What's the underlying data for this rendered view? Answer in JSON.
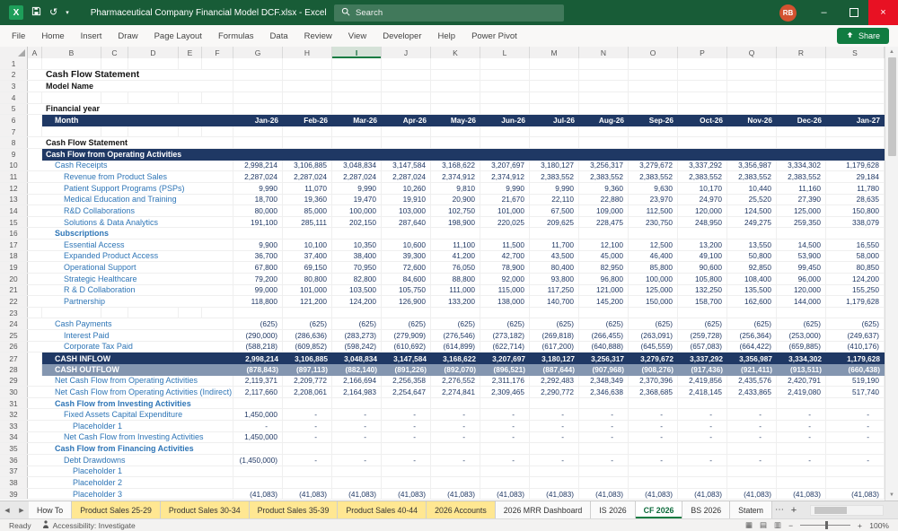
{
  "titlebar": {
    "title": "Pharmaceutical Company Financial Model DCF.xlsx  -  Excel",
    "search_placeholder": "Search",
    "avatar_initials": "RB"
  },
  "ribbon": {
    "tabs": [
      "File",
      "Home",
      "Insert",
      "Draw",
      "Page Layout",
      "Formulas",
      "Data",
      "Review",
      "View",
      "Developer",
      "Help",
      "Power Pivot"
    ],
    "share_label": "Share"
  },
  "icons": {
    "app": "X",
    "undo": "↺",
    "dropdown": "▾",
    "minimize": "–",
    "close": "×",
    "up": "▲",
    "down": "▼",
    "tab_prev": "◀",
    "tab_next": "▶",
    "more": "⋯",
    "add": "+",
    "view_normal": "▦",
    "view_layout": "▤",
    "view_break": "▥",
    "zoom_out": "−",
    "zoom_in": "+"
  },
  "grid": {
    "columns": [
      "A",
      "B",
      "C",
      "D",
      "E",
      "F",
      "G",
      "H",
      "I",
      "J",
      "K",
      "L",
      "M",
      "N",
      "O",
      "P",
      "Q",
      "R",
      "S"
    ],
    "selected_column": "I",
    "rows": [
      {
        "n": 1
      },
      {
        "n": 2,
        "s": "title",
        "t": "Cash Flow Statement"
      },
      {
        "n": 3,
        "s": "bold",
        "t": "Model Name"
      },
      {
        "n": 4
      },
      {
        "n": 5,
        "s": "bold",
        "t": "Financial year"
      },
      {
        "n": 6,
        "s": "months",
        "t": "Month",
        "v": [
          "Jan-26",
          "Feb-26",
          "Mar-26",
          "Apr-26",
          "May-26",
          "Jun-26",
          "Jul-26",
          "Aug-26",
          "Sep-26",
          "Oct-26",
          "Nov-26",
          "Dec-26",
          "Jan-27"
        ]
      },
      {
        "n": 7
      },
      {
        "n": 8,
        "s": "bold",
        "t": "Cash Flow Statement"
      },
      {
        "n": 9,
        "s": "band",
        "t": "Cash Flow from Operating Activities"
      },
      {
        "n": 10,
        "s": "lbl",
        "i": 1,
        "t": "Cash Receipts",
        "v": [
          "2,998,214",
          "3,106,885",
          "3,048,834",
          "3,147,584",
          "3,168,622",
          "3,207,697",
          "3,180,127",
          "3,256,317",
          "3,279,672",
          "3,337,292",
          "3,356,987",
          "3,334,302",
          "1,179,628"
        ]
      },
      {
        "n": 11,
        "s": "lbl",
        "i": 2,
        "t": "Revenue from Product Sales",
        "v": [
          "2,287,024",
          "2,287,024",
          "2,287,024",
          "2,287,024",
          "2,374,912",
          "2,374,912",
          "2,383,552",
          "2,383,552",
          "2,383,552",
          "2,383,552",
          "2,383,552",
          "2,383,552",
          "29,184"
        ]
      },
      {
        "n": 12,
        "s": "lbl",
        "i": 2,
        "t": "Patient Support Programs (PSPs)",
        "v": [
          "9,990",
          "11,070",
          "9,990",
          "10,260",
          "9,810",
          "9,990",
          "9,990",
          "9,360",
          "9,630",
          "10,170",
          "10,440",
          "11,160",
          "11,780"
        ]
      },
      {
        "n": 13,
        "s": "lbl",
        "i": 2,
        "t": "Medical Education and Training",
        "v": [
          "18,700",
          "19,360",
          "19,470",
          "19,910",
          "20,900",
          "21,670",
          "22,110",
          "22,880",
          "23,970",
          "24,970",
          "25,520",
          "27,390",
          "28,635"
        ]
      },
      {
        "n": 14,
        "s": "lbl",
        "i": 2,
        "t": "R&D Collaborations",
        "v": [
          "80,000",
          "85,000",
          "100,000",
          "103,000",
          "102,750",
          "101,000",
          "67,500",
          "109,000",
          "112,500",
          "120,000",
          "124,500",
          "125,000",
          "150,800"
        ]
      },
      {
        "n": 15,
        "s": "lbl",
        "i": 2,
        "t": "Solutions & Data Analytics",
        "v": [
          "191,100",
          "285,111",
          "202,150",
          "287,640",
          "198,900",
          "220,025",
          "209,625",
          "228,475",
          "230,750",
          "248,950",
          "249,275",
          "259,350",
          "338,079"
        ]
      },
      {
        "n": 16,
        "s": "sec",
        "i": 1,
        "t": "Subscriptions"
      },
      {
        "n": 17,
        "s": "lbl",
        "i": 2,
        "t": "Essential Access",
        "v": [
          "9,900",
          "10,100",
          "10,350",
          "10,600",
          "11,100",
          "11,500",
          "11,700",
          "12,100",
          "12,500",
          "13,200",
          "13,550",
          "14,500",
          "16,550"
        ]
      },
      {
        "n": 18,
        "s": "lbl",
        "i": 2,
        "t": "Expanded Product Access",
        "v": [
          "36,700",
          "37,400",
          "38,400",
          "39,300",
          "41,200",
          "42,700",
          "43,500",
          "45,000",
          "46,400",
          "49,100",
          "50,800",
          "53,900",
          "58,000"
        ]
      },
      {
        "n": 19,
        "s": "lbl",
        "i": 2,
        "t": "Operational Support",
        "v": [
          "67,800",
          "69,150",
          "70,950",
          "72,600",
          "76,050",
          "78,900",
          "80,400",
          "82,950",
          "85,800",
          "90,600",
          "92,850",
          "99,450",
          "80,850"
        ]
      },
      {
        "n": 20,
        "s": "lbl",
        "i": 2,
        "t": "Strategic Healthcare",
        "v": [
          "79,200",
          "80,800",
          "82,800",
          "84,600",
          "88,800",
          "92,000",
          "93,800",
          "96,800",
          "100,000",
          "105,800",
          "108,400",
          "96,000",
          "124,200"
        ]
      },
      {
        "n": 21,
        "s": "lbl",
        "i": 2,
        "t": "R & D Collaboration",
        "v": [
          "99,000",
          "101,000",
          "103,500",
          "105,750",
          "111,000",
          "115,000",
          "117,250",
          "121,000",
          "125,000",
          "132,250",
          "135,500",
          "120,000",
          "155,250"
        ]
      },
      {
        "n": 22,
        "s": "lbl",
        "i": 2,
        "t": "Partnership",
        "v": [
          "118,800",
          "121,200",
          "124,200",
          "126,900",
          "133,200",
          "138,000",
          "140,700",
          "145,200",
          "150,000",
          "158,700",
          "162,600",
          "144,000",
          "1,179,628"
        ]
      },
      {
        "n": 23
      },
      {
        "n": 24,
        "s": "lbl",
        "i": 1,
        "t": "Cash Payments",
        "v": [
          "(625)",
          "(625)",
          "(625)",
          "(625)",
          "(625)",
          "(625)",
          "(625)",
          "(625)",
          "(625)",
          "(625)",
          "(625)",
          "(625)",
          "(625)"
        ]
      },
      {
        "n": 25,
        "s": "lbl",
        "i": 2,
        "t": "Interest Paid",
        "v": [
          "(290,000)",
          "(286,636)",
          "(283,273)",
          "(279,909)",
          "(276,546)",
          "(273,182)",
          "(269,818)",
          "(266,455)",
          "(263,091)",
          "(259,728)",
          "(256,364)",
          "(253,000)",
          "(249,637)"
        ]
      },
      {
        "n": 26,
        "s": "lbl",
        "i": 2,
        "t": "Corporate Tax Paid",
        "v": [
          "(588,218)",
          "(609,852)",
          "(598,242)",
          "(610,692)",
          "(614,899)",
          "(622,714)",
          "(617,200)",
          "(640,888)",
          "(645,559)",
          "(657,083)",
          "(664,422)",
          "(659,885)",
          "(410,176)"
        ]
      },
      {
        "n": 27,
        "s": "inflow",
        "t": "CASH INFLOW",
        "v": [
          "2,998,214",
          "3,106,885",
          "3,048,834",
          "3,147,584",
          "3,168,622",
          "3,207,697",
          "3,180,127",
          "3,256,317",
          "3,279,672",
          "3,337,292",
          "3,356,987",
          "3,334,302",
          "1,179,628"
        ]
      },
      {
        "n": 28,
        "s": "outflow",
        "t": "CASH OUTFLOW",
        "v": [
          "(878,843)",
          "(897,113)",
          "(882,140)",
          "(891,226)",
          "(892,070)",
          "(896,521)",
          "(887,644)",
          "(907,968)",
          "(908,276)",
          "(917,436)",
          "(921,411)",
          "(913,511)",
          "(660,438)"
        ]
      },
      {
        "n": 29,
        "s": "lbl",
        "i": 1,
        "t": "Net Cash Flow from Operating Activities",
        "v": [
          "2,119,371",
          "2,209,772",
          "2,166,694",
          "2,256,358",
          "2,276,552",
          "2,311,176",
          "2,292,483",
          "2,348,349",
          "2,370,396",
          "2,419,856",
          "2,435,576",
          "2,420,791",
          "519,190"
        ]
      },
      {
        "n": 30,
        "s": "lbl",
        "i": 1,
        "t": "Net Cash Flow from Operating Activities (Indirect)",
        "v": [
          "2,117,660",
          "2,208,061",
          "2,164,983",
          "2,254,647",
          "2,274,841",
          "2,309,465",
          "2,290,772",
          "2,346,638",
          "2,368,685",
          "2,418,145",
          "2,433,865",
          "2,419,080",
          "517,740"
        ]
      },
      {
        "n": 31,
        "s": "sec",
        "i": 1,
        "t": "Cash Flow from Investing Activities"
      },
      {
        "n": 32,
        "s": "lbl",
        "i": 2,
        "t": "Fixed Assets Capital Expenditure",
        "v": [
          "1,450,000",
          "-",
          "-",
          "-",
          "-",
          "-",
          "-",
          "-",
          "-",
          "-",
          "-",
          "-",
          "-"
        ]
      },
      {
        "n": 33,
        "s": "lbl",
        "i": 3,
        "t": "Placeholder 1",
        "v": [
          "-",
          "-",
          "-",
          "-",
          "-",
          "-",
          "-",
          "-",
          "-",
          "-",
          "-",
          "-",
          "-"
        ]
      },
      {
        "n": 34,
        "s": "lbl",
        "i": 2,
        "t": "Net Cash Flow from Investing Activities",
        "v": [
          "1,450,000",
          "-",
          "-",
          "-",
          "-",
          "-",
          "-",
          "-",
          "-",
          "-",
          "-",
          "-",
          "-"
        ]
      },
      {
        "n": 35,
        "s": "sec",
        "i": 1,
        "t": "Cash Flow from Financing Activities"
      },
      {
        "n": 36,
        "s": "lbl",
        "i": 2,
        "t": "Debt Drawdowns",
        "v": [
          "(1,450,000)",
          "-",
          "-",
          "-",
          "-",
          "-",
          "-",
          "-",
          "-",
          "-",
          "-",
          "-",
          "-"
        ]
      },
      {
        "n": 37,
        "s": "lbl",
        "i": 3,
        "t": "Placeholder 1"
      },
      {
        "n": 38,
        "s": "lbl",
        "i": 3,
        "t": "Placeholder 2"
      },
      {
        "n": 39,
        "s": "lbl",
        "i": 3,
        "t": "Placeholder 3",
        "v": [
          "(41,083)",
          "(41,083)",
          "(41,083)",
          "(41,083)",
          "(41,083)",
          "(41,083)",
          "(41,083)",
          "(41,083)",
          "(41,083)",
          "(41,083)",
          "(41,083)",
          "(41,083)",
          "(41,083)"
        ]
      }
    ]
  },
  "sheettabs": {
    "items": [
      {
        "label": "How To",
        "color": "white"
      },
      {
        "label": "Product Sales 25-29",
        "color": "yellow"
      },
      {
        "label": "Product Sales 30-34",
        "color": "yellow"
      },
      {
        "label": "Product Sales 35-39",
        "color": "yellow"
      },
      {
        "label": "Product Sales 40-44",
        "color": "yellow"
      },
      {
        "label": "2026 Accounts",
        "color": "yellow"
      },
      {
        "label": "2026 MRR Dashboard",
        "color": "white"
      },
      {
        "label": "IS 2026",
        "color": "white"
      },
      {
        "label": "CF 2026",
        "color": "white",
        "active": true
      },
      {
        "label": "BS 2026",
        "color": "white"
      },
      {
        "label": "Statem",
        "color": "white"
      }
    ]
  },
  "statusbar": {
    "ready": "Ready",
    "accessibility": "Accessibility: Investigate",
    "zoom": "100%"
  }
}
